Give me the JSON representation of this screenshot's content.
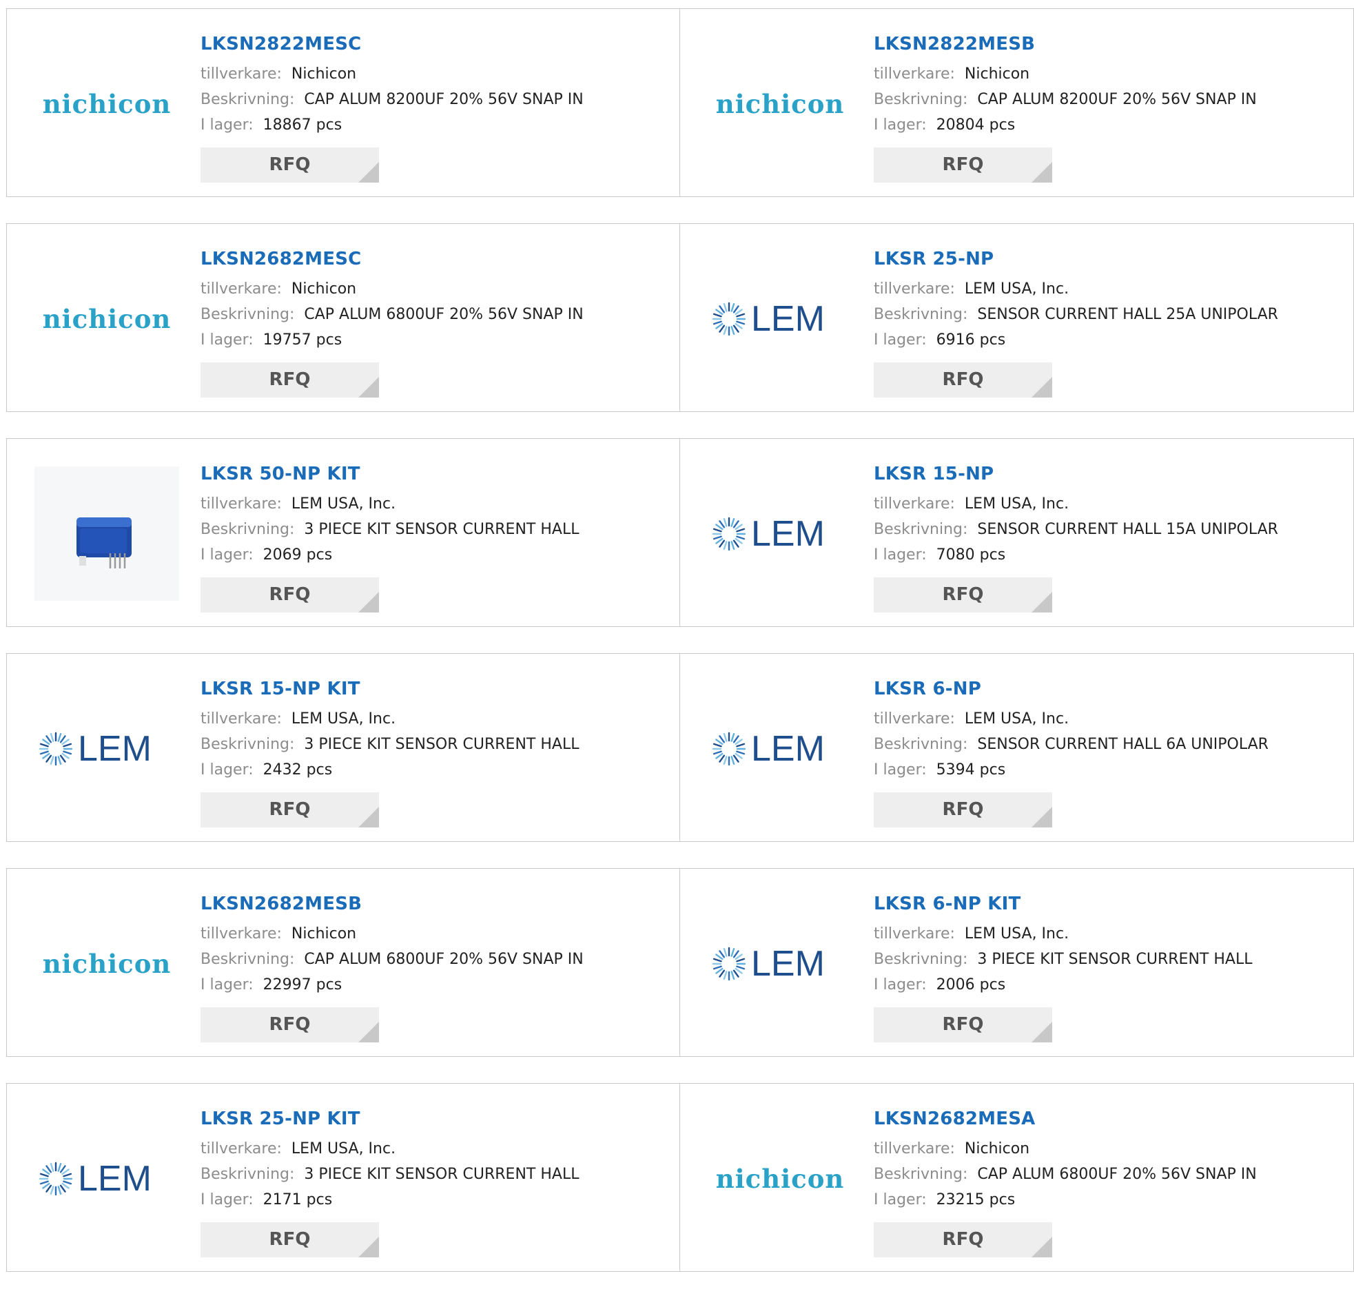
{
  "labels": {
    "manufacturer": "tillverkare:",
    "description": "Beskrivning:",
    "stock": "I lager:",
    "rfq": "RFQ"
  },
  "logos": {
    "nichicon": {
      "text": "nichicon",
      "color": "#2aa2c8"
    },
    "lem": {
      "text": "LEM",
      "color": "#1f4e8c"
    }
  },
  "products": [
    {
      "part": "LKSN2822MESC",
      "logo": "nichicon",
      "manufacturer": "Nichicon",
      "description": "CAP ALUM 8200UF 20% 56V SNAP IN",
      "stock": "18867 pcs"
    },
    {
      "part": "LKSN2822MESB",
      "logo": "nichicon",
      "manufacturer": "Nichicon",
      "description": "CAP ALUM 8200UF 20% 56V SNAP IN",
      "stock": "20804 pcs"
    },
    {
      "part": "LKSN2682MESC",
      "logo": "nichicon",
      "manufacturer": "Nichicon",
      "description": "CAP ALUM 6800UF 20% 56V SNAP IN",
      "stock": "19757 pcs"
    },
    {
      "part": "LKSR 25-NP",
      "logo": "lem",
      "manufacturer": "LEM USA, Inc.",
      "description": "SENSOR CURRENT HALL 25A UNIPOLAR",
      "stock": "6916 pcs"
    },
    {
      "part": "LKSR 50-NP KIT",
      "logo": "sensor-photo",
      "manufacturer": "LEM USA, Inc.",
      "description": "3 PIECE KIT SENSOR CURRENT HALL",
      "stock": "2069 pcs"
    },
    {
      "part": "LKSR 15-NP",
      "logo": "lem",
      "manufacturer": "LEM USA, Inc.",
      "description": "SENSOR CURRENT HALL 15A UNIPOLAR",
      "stock": "7080 pcs"
    },
    {
      "part": "LKSR 15-NP KIT",
      "logo": "lem",
      "manufacturer": "LEM USA, Inc.",
      "description": "3 PIECE KIT SENSOR CURRENT HALL",
      "stock": "2432 pcs"
    },
    {
      "part": "LKSR 6-NP",
      "logo": "lem",
      "manufacturer": "LEM USA, Inc.",
      "description": "SENSOR CURRENT HALL 6A UNIPOLAR",
      "stock": "5394 pcs"
    },
    {
      "part": "LKSN2682MESB",
      "logo": "nichicon",
      "manufacturer": "Nichicon",
      "description": "CAP ALUM 6800UF 20% 56V SNAP IN",
      "stock": "22997 pcs"
    },
    {
      "part": "LKSR 6-NP KIT",
      "logo": "lem",
      "manufacturer": "LEM USA, Inc.",
      "description": "3 PIECE KIT SENSOR CURRENT HALL",
      "stock": "2006 pcs"
    },
    {
      "part": "LKSR 25-NP KIT",
      "logo": "lem",
      "manufacturer": "LEM USA, Inc.",
      "description": "3 PIECE KIT SENSOR CURRENT HALL",
      "stock": "2171 pcs"
    },
    {
      "part": "LKSN2682MESA",
      "logo": "nichicon",
      "manufacturer": "Nichicon",
      "description": "CAP ALUM 6800UF 20% 56V SNAP IN",
      "stock": "23215 pcs"
    }
  ]
}
